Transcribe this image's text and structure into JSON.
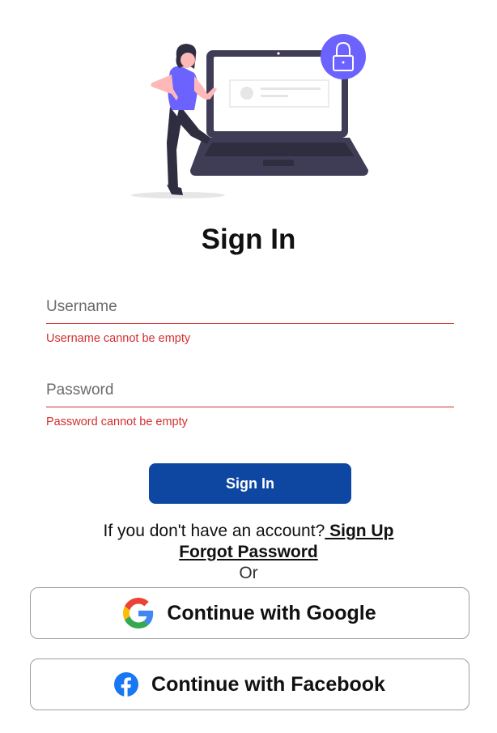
{
  "header": {
    "title": "Sign In"
  },
  "form": {
    "username": {
      "placeholder": "Username",
      "value": "",
      "error": "Username cannot be empty"
    },
    "password": {
      "placeholder": "Password",
      "value": "",
      "error": "Password cannot be empty"
    },
    "submit_label": "Sign In"
  },
  "links": {
    "signup_prompt": "If you don't have an account?",
    "signup_label": " Sign Up",
    "forgot_label": "Forgot Password",
    "or_label": "Or"
  },
  "social": {
    "google_label": "Continue with Google",
    "google_icon": "google-icon",
    "facebook_label": "Continue with Facebook",
    "facebook_icon": "facebook-icon"
  },
  "colors": {
    "accent": "#0d47a1",
    "error": "#d32f2f",
    "illustration_purple": "#6c63ff",
    "illustration_dark": "#3f3d56"
  }
}
